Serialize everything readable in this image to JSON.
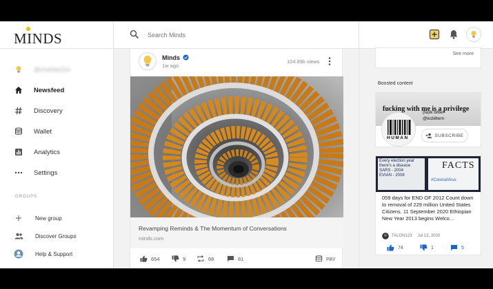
{
  "brand": {
    "name": "MINDS"
  },
  "search": {
    "placeholder": "Search Minds"
  },
  "sidebar": {
    "user_handle": "@charlep11e",
    "items": [
      {
        "label": "Newsfeed",
        "icon": "home-icon"
      },
      {
        "label": "Discovery",
        "icon": "hashtag-icon"
      },
      {
        "label": "Wallet",
        "icon": "wallet-icon"
      },
      {
        "label": "Analytics",
        "icon": "analytics-icon"
      },
      {
        "label": "Settings",
        "icon": "more-horizontal-icon"
      }
    ],
    "groups_label": "GROUPS",
    "groups": [
      {
        "label": "New group",
        "icon": "plus-icon"
      },
      {
        "label": "Discover Groups",
        "icon": "people-icon"
      },
      {
        "label": "Help & Support",
        "icon": "support-avatar-icon"
      }
    ]
  },
  "post": {
    "author": "Minds",
    "time": "1w ago",
    "views": "104.89k views",
    "link_title": "Revamping Reminds & The Momentum of Conversations",
    "link_domain": "minds.com",
    "actions": {
      "upvotes": "654",
      "downvotes": "9",
      "reminds": "68",
      "comments": "81",
      "pay": "PAY"
    }
  },
  "right_panel": {
    "see_more": "See more",
    "boosted_label": "Boosted content",
    "boost_card": {
      "banner_text": "fucking with me is a privilege",
      "handle_line1": "(ta)lk bitter",
      "handle_line2": "@kcbittern",
      "avatar_text": "HUMAN",
      "subscribe_label": "SUBSCRIBE"
    },
    "media_card": {
      "thumb_text_left": "Every election year",
      "thumb_text_left2": "there's a disease",
      "thumb_text_left3": "SARS - 2004",
      "thumb_text_left4": "EVIAN - 2008",
      "thumb_text_right": "FACTS",
      "thumb_tag": "#CoronaVirus",
      "text": "059 days for END OF 2012 Count down to removal of 229 million United States Citizens. 11 September 2020 Ethiopian New Year 2013 begins Welco...",
      "author": "TALON123",
      "date": "Jul 13, 2020",
      "upvotes": "74",
      "downvotes": "1",
      "comments": "5"
    }
  },
  "colors": {
    "accent_blue": "#1b63c7",
    "bulb_yellow": "#f2c94c",
    "background": "#f2f2f2"
  }
}
